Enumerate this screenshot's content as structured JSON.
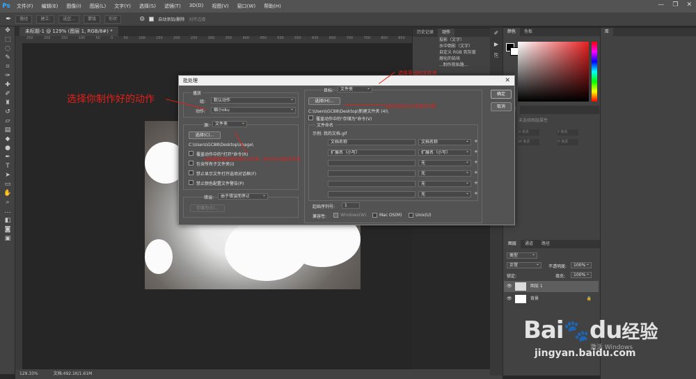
{
  "menubar": {
    "logo": "Ps",
    "items": [
      "文件(F)",
      "编辑(E)",
      "图像(I)",
      "图层(L)",
      "文字(Y)",
      "选择(S)",
      "滤镜(T)",
      "3D(D)",
      "视图(V)",
      "窗口(W)",
      "帮助(H)"
    ],
    "window_controls": [
      "—",
      "❐",
      "✕"
    ]
  },
  "optionsbar": {
    "items": [
      "路径",
      "建立:",
      "选区...",
      "蒙版",
      "形状"
    ],
    "auto_add_delete": "自动添加/删除",
    "align_edges": "对齐边缘"
  },
  "document": {
    "tab_title": "未标题-1 @ 129% (图层 1, RGB/8#) *",
    "ruler_ticks": [
      "250",
      "200",
      "150",
      "100",
      "50",
      "0",
      "50",
      "100",
      "150",
      "200",
      "250",
      "300",
      "350",
      "400",
      "450",
      "500",
      "550",
      "600",
      "650",
      "700",
      "750",
      "800",
      "850"
    ]
  },
  "statusbar": {
    "zoom": "129.33%",
    "doc_info": "文档:492.1K/1.61M"
  },
  "actions_panel": {
    "tabs": [
      "历史记录",
      "动作"
    ],
    "rows": [
      "投影（文字）",
      "水中倒影（文字）",
      "自定义 RGB 到灰度",
      "熔化的铅块",
      "...制作剪贴路..."
    ]
  },
  "color_panel": {
    "tabs": [
      "颜色",
      "色板"
    ]
  },
  "library_panel": {
    "tabs": [
      "库"
    ]
  },
  "adjust_panel": {
    "tabs": [
      "调整"
    ],
    "hint": "未选择图层属性",
    "fields": [
      "X 像素",
      "Y 像素",
      "W 像素",
      "H 像素"
    ]
  },
  "layers_panel": {
    "tabs": [
      "图层",
      "通道",
      "路径"
    ],
    "kind": "类型",
    "blend": "正常",
    "opacity_label": "不透明度:",
    "opacity": "100%",
    "lock_label": "锁定:",
    "fill_label": "填充:",
    "fill": "100%",
    "layers": [
      {
        "name": "图层 1",
        "selected": true
      },
      {
        "name": "背景",
        "locked": true
      }
    ]
  },
  "dialog": {
    "title": "批处理",
    "close": "✕",
    "ok": "确定",
    "cancel": "取消",
    "play": {
      "legend": "播放",
      "set_label": "组:",
      "set_value": "默认动作",
      "action_label": "动作:",
      "action_value": "缩小oku"
    },
    "source": {
      "label": "源:",
      "value": "文件夹",
      "choose": "选择(C)...",
      "path": "C:\\Users\\GC88\\Desktop\\image\\",
      "checks": [
        "覆盖动作中的\"打开\"命令(R)",
        "包含所有子文件夹(I)",
        "禁止显示文件打开选项对话框(F)",
        "禁止颜色配置文件警告(P)"
      ]
    },
    "errors": {
      "label": "错误:",
      "value": "由于错误而停止",
      "save_as": "存储为(E)..."
    },
    "destination": {
      "label": "目标:",
      "value": "文件夹",
      "choose": "选择(H)...",
      "path": "C:\\Users\\GC88\\Desktop\\新建文件夹 (4)\\",
      "override_save": "覆盖动作中的\"存储为\"命令(V)"
    },
    "naming": {
      "legend": "文件命名",
      "example": "示例: 我的文档.gif",
      "rows": [
        {
          "left": "文档名称",
          "right": "文档名称"
        },
        {
          "left": "扩展名（小写）",
          "right": "扩展名（小写）"
        },
        {
          "left": "",
          "right": "无"
        },
        {
          "left": "",
          "right": "无"
        },
        {
          "left": "",
          "right": "无"
        },
        {
          "left": "",
          "right": "无"
        }
      ],
      "serial_label": "起始序列号:",
      "serial_value": "1",
      "compat_label": "兼容性:",
      "compat": [
        "Windows(W)",
        "Mac OS(M)",
        "Unix(U)"
      ]
    }
  },
  "annotations": {
    "choose_action": "选择你制作好的动作",
    "select_target": "选择导出的文件夹",
    "select_target2": "选择导出的文件夹保存位置",
    "select_source": "选择要批量处理的图片文件夹，表示可以选择文件夹"
  },
  "watermark": {
    "brand": "Bai",
    "brand2": "du",
    "cn": "经验",
    "url": "jingyan.baidu.com",
    "activate": "激活 Windows"
  },
  "colors": {
    "accent": "#31a8ff",
    "annotation": "#e0201a",
    "panel": "#424242",
    "dialog": "#535353"
  }
}
